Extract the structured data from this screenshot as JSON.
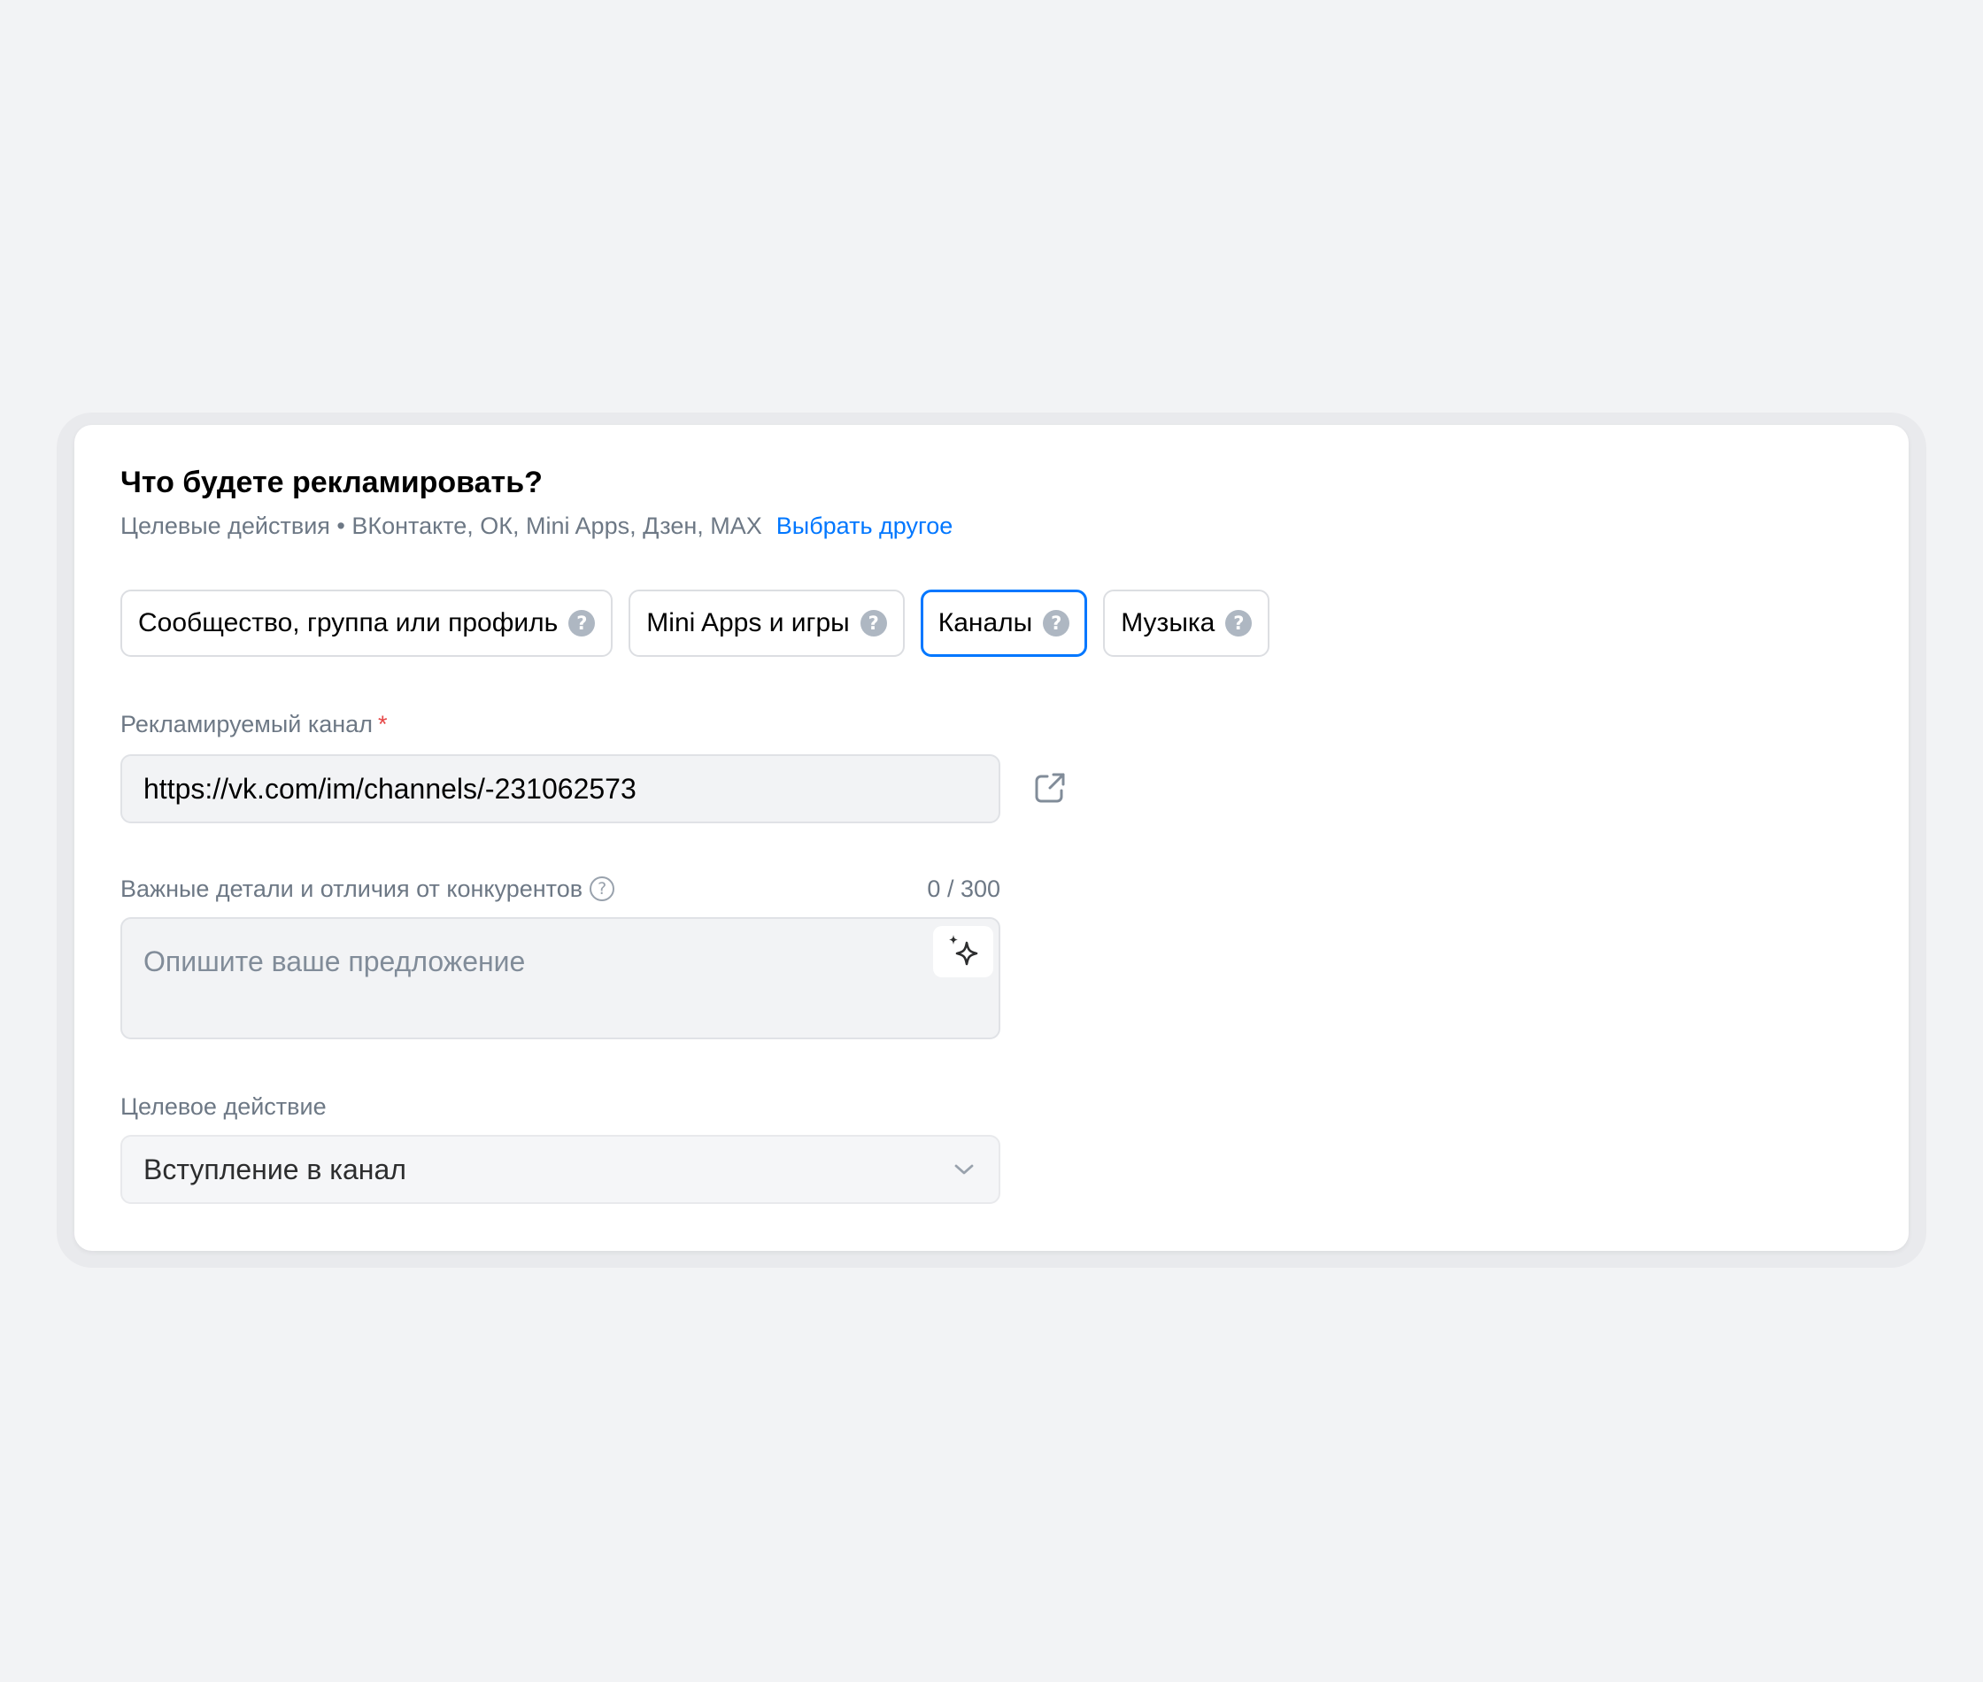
{
  "section": {
    "title": "Что будете рекламировать?",
    "subtitle": "Целевые действия • ВКонтакте, ОК, Mini Apps, Дзен, MAX",
    "change_link": "Выбрать другое"
  },
  "tabs": [
    {
      "label": "Сообщество, группа или профиль",
      "selected": false,
      "icon": "help-circle-icon"
    },
    {
      "label": "Mini Apps и игры",
      "selected": false,
      "icon": "help-circle-icon"
    },
    {
      "label": "Каналы",
      "selected": true,
      "icon": "help-circle-icon"
    },
    {
      "label": "Музыка",
      "selected": false,
      "icon": "help-circle-icon"
    }
  ],
  "channel_field": {
    "label": "Рекламируемый канал",
    "required_mark": "*",
    "value": "https://vk.com/im/channels/-231062573",
    "icon": "external-link-icon"
  },
  "details_field": {
    "label": "Важные детали и отличия от конкурентов",
    "counter": "0 / 300",
    "placeholder": "Опишите ваше предложение",
    "icon": "sparkle-icon"
  },
  "target_action": {
    "label": "Целевое действие",
    "selected_value": "Вступление в канал",
    "icon": "chevron-down-icon"
  },
  "colors": {
    "accent": "#0077ff",
    "required": "#e64646",
    "muted_text": "#6d7885",
    "background": "#f2f3f5"
  }
}
